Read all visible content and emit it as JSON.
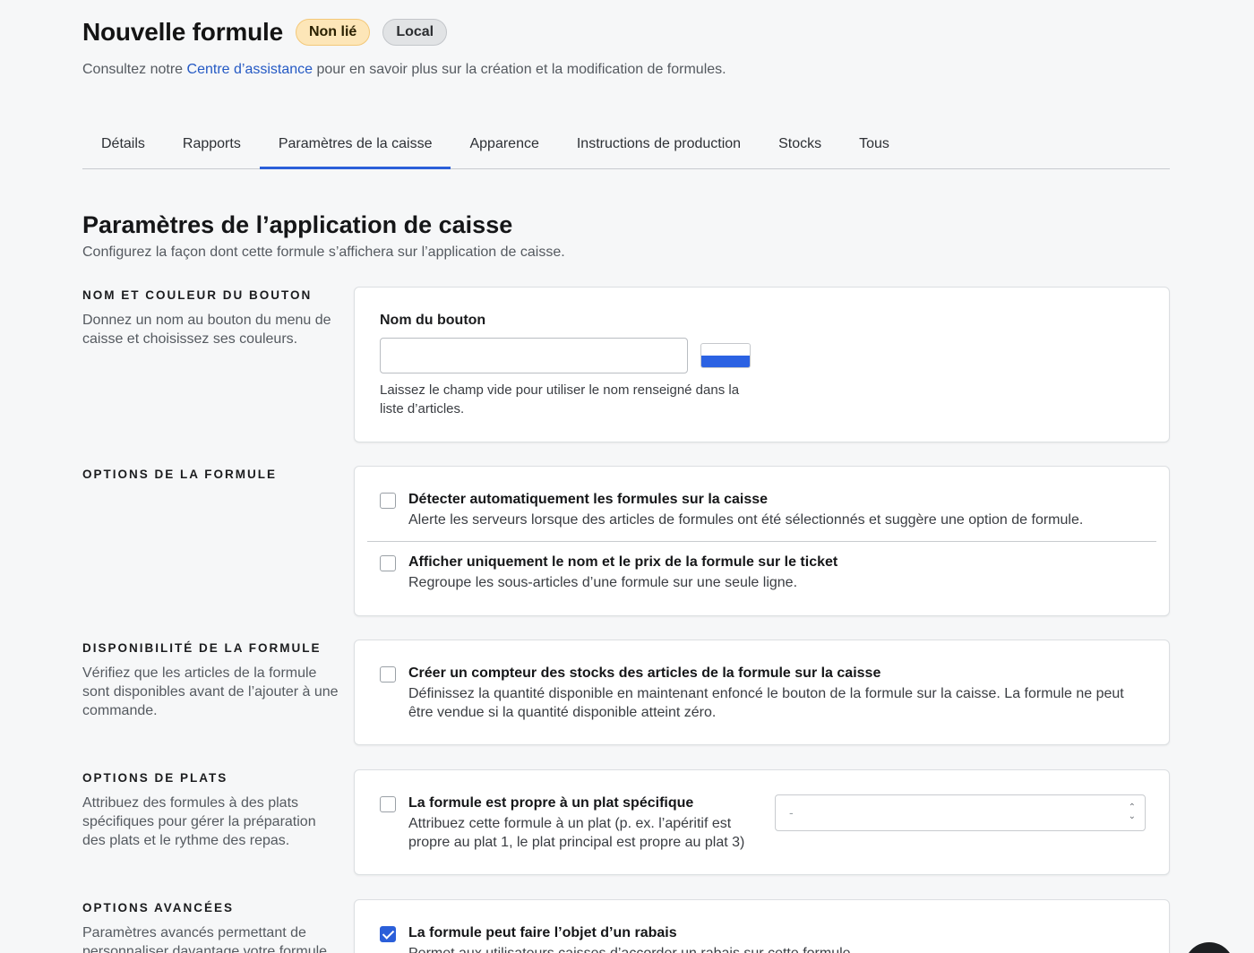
{
  "header": {
    "title": "Nouvelle formule",
    "badge_unlinked": "Non lié",
    "badge_local": "Local",
    "help_prefix": "Consultez notre ",
    "help_link": "Centre d’assistance",
    "help_suffix": " pour en savoir plus sur la création et la modification de formules."
  },
  "tabs": [
    {
      "label": "Détails"
    },
    {
      "label": "Rapports"
    },
    {
      "label": "Paramètres de la caisse",
      "active": true
    },
    {
      "label": "Apparence"
    },
    {
      "label": "Instructions de production"
    },
    {
      "label": "Stocks"
    },
    {
      "label": "Tous"
    }
  ],
  "section": {
    "title": "Paramètres de l’application de caisse",
    "subtitle": "Configurez la façon dont cette formule s’affichera sur l’application de caisse."
  },
  "groups": {
    "button": {
      "title": "Nom et couleur du bouton",
      "desc": "Donnez un nom au bouton du menu de caisse et choisissez ses couleurs.",
      "field_label": "Nom du bouton",
      "field_value": "",
      "field_placeholder": "",
      "hint": "Laissez le champ vide pour utiliser le nom renseigné dans la liste d’articles.",
      "color": "#2b62e3"
    },
    "options": {
      "title": "Options de la formule",
      "items": [
        {
          "title": "Détecter automatiquement les formules sur la caisse",
          "desc": "Alerte les serveurs lorsque des articles de formules ont été sélectionnés et suggère une option de formule.",
          "checked": false
        },
        {
          "title": "Afficher uniquement le nom et le prix de la formule sur le ticket",
          "desc": "Regroupe les sous-articles d’une formule sur une seule ligne.",
          "checked": false
        }
      ]
    },
    "availability": {
      "title": "Disponibilité de la formule",
      "desc": "Vérifiez que les articles de la formule sont disponibles avant de l’ajouter à une commande.",
      "item": {
        "title": "Créer un compteur des stocks des articles de la formule sur la caisse",
        "desc": "Définissez la quantité disponible en maintenant enfoncé le bouton de la formule sur la caisse. La formule ne peut être vendue si la quantité disponible atteint zéro.",
        "checked": false
      }
    },
    "courses": {
      "title": "Options de plats",
      "desc": "Attribuez des formules à des plats spécifiques pour gérer la préparation des plats et le rythme des repas.",
      "item": {
        "title": "La formule est propre à un plat spécifique",
        "desc": "Attribuez cette formule à un plat (p. ex. l’apéritif est propre au plat 1, le plat principal est propre au plat 3)",
        "checked": false
      },
      "select_value": "-"
    },
    "advanced": {
      "title": "Options avancées",
      "desc": "Paramètres avancés permettant de personnaliser davantage votre formule.",
      "item": {
        "title": "La formule peut faire l’objet d’un rabais",
        "desc": "Permet aux utilisateurs caisses d’accorder un rabais sur cette formule.",
        "checked": true
      }
    }
  }
}
